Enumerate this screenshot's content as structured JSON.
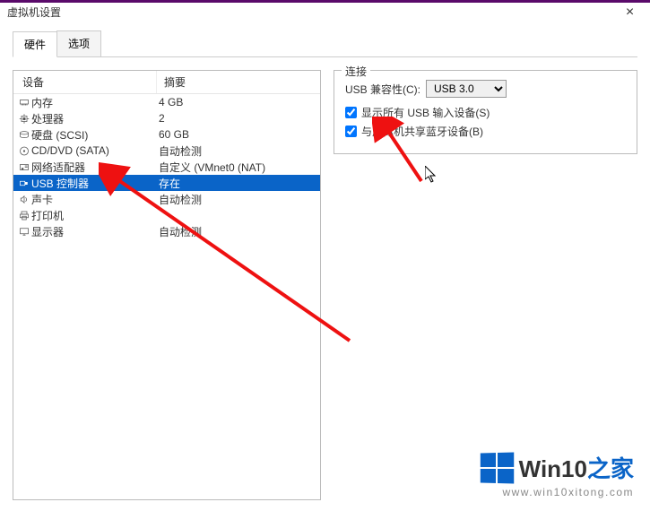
{
  "window": {
    "title": "虚拟机设置",
    "close": "×"
  },
  "tabs": {
    "hardware": "硬件",
    "options": "选项"
  },
  "list": {
    "header": {
      "device": "设备",
      "summary": "摘要"
    },
    "items": [
      {
        "icon": "memory",
        "label": "内存",
        "summary": "4 GB"
      },
      {
        "icon": "cpu",
        "label": "处理器",
        "summary": "2"
      },
      {
        "icon": "hdd",
        "label": "硬盘 (SCSI)",
        "summary": "60 GB"
      },
      {
        "icon": "disc",
        "label": "CD/DVD (SATA)",
        "summary": "自动检测"
      },
      {
        "icon": "net",
        "label": "网络适配器",
        "summary": "自定义 (VMnet0 (NAT)"
      },
      {
        "icon": "usb",
        "label": "USB 控制器",
        "summary": "存在",
        "selected": true
      },
      {
        "icon": "sound",
        "label": "声卡",
        "summary": "自动检测"
      },
      {
        "icon": "printer",
        "label": "打印机",
        "summary": ""
      },
      {
        "icon": "display",
        "label": "显示器",
        "summary": "自动检测"
      }
    ]
  },
  "connection": {
    "groupTitle": "连接",
    "compatLabel": "USB 兼容性(C):",
    "compatValue": "USB 3.0",
    "showAll": "显示所有 USB 输入设备(S)",
    "shareBt": "与虚拟机共享蓝牙设备(B)"
  },
  "watermark": {
    "brand_a": "Win10",
    "brand_b": "之家",
    "url": "www.win10xitong.com"
  }
}
